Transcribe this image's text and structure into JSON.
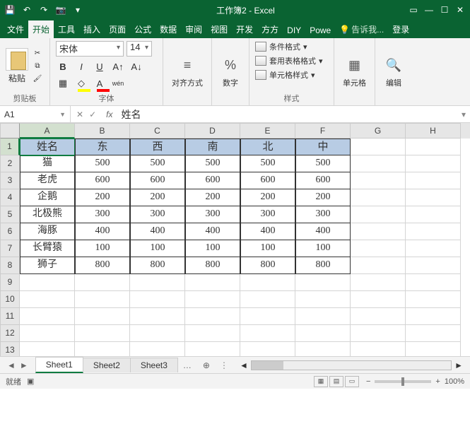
{
  "title": "工作簿2 - Excel",
  "tabs": [
    "文件",
    "开始",
    "工具",
    "插入",
    "页面",
    "公式",
    "数据",
    "审阅",
    "视图",
    "开发",
    "方方",
    "DIY",
    "Powe"
  ],
  "active_tab": 1,
  "tell_me": "告诉我...",
  "login": "登录",
  "groups": {
    "clipboard": {
      "label": "剪贴板",
      "paste": "粘贴"
    },
    "font": {
      "label": "字体",
      "name": "宋体",
      "size": "14"
    },
    "align": {
      "label": "对齐方式"
    },
    "number": {
      "label": "数字",
      "pct": "%"
    },
    "styles": {
      "label": "样式",
      "cond": "条件格式",
      "table": "套用表格格式",
      "cell": "单元格样式"
    },
    "cells": {
      "label": "单元格"
    },
    "editing": {
      "label": "编辑"
    }
  },
  "name_box": "A1",
  "formula": "姓名",
  "columns": [
    "A",
    "B",
    "C",
    "D",
    "E",
    "F",
    "G",
    "H"
  ],
  "row_nums": [
    1,
    2,
    3,
    4,
    5,
    6,
    7,
    8,
    9,
    10,
    11,
    12,
    13
  ],
  "chart_data": {
    "type": "table",
    "headers": [
      "姓名",
      "东",
      "西",
      "南",
      "北",
      "中"
    ],
    "rows": [
      [
        "猫",
        500,
        500,
        500,
        500,
        500
      ],
      [
        "老虎",
        600,
        600,
        600,
        600,
        600
      ],
      [
        "企鹅",
        200,
        200,
        200,
        200,
        200
      ],
      [
        "北极熊",
        300,
        300,
        300,
        300,
        300
      ],
      [
        "海豚",
        400,
        400,
        400,
        400,
        400
      ],
      [
        "长臂猿",
        100,
        100,
        100,
        100,
        100
      ],
      [
        "狮子",
        800,
        800,
        800,
        800,
        800
      ]
    ]
  },
  "sheets": [
    "Sheet1",
    "Sheet2",
    "Sheet3"
  ],
  "active_sheet": 0,
  "status": "就绪",
  "zoom": "100%"
}
